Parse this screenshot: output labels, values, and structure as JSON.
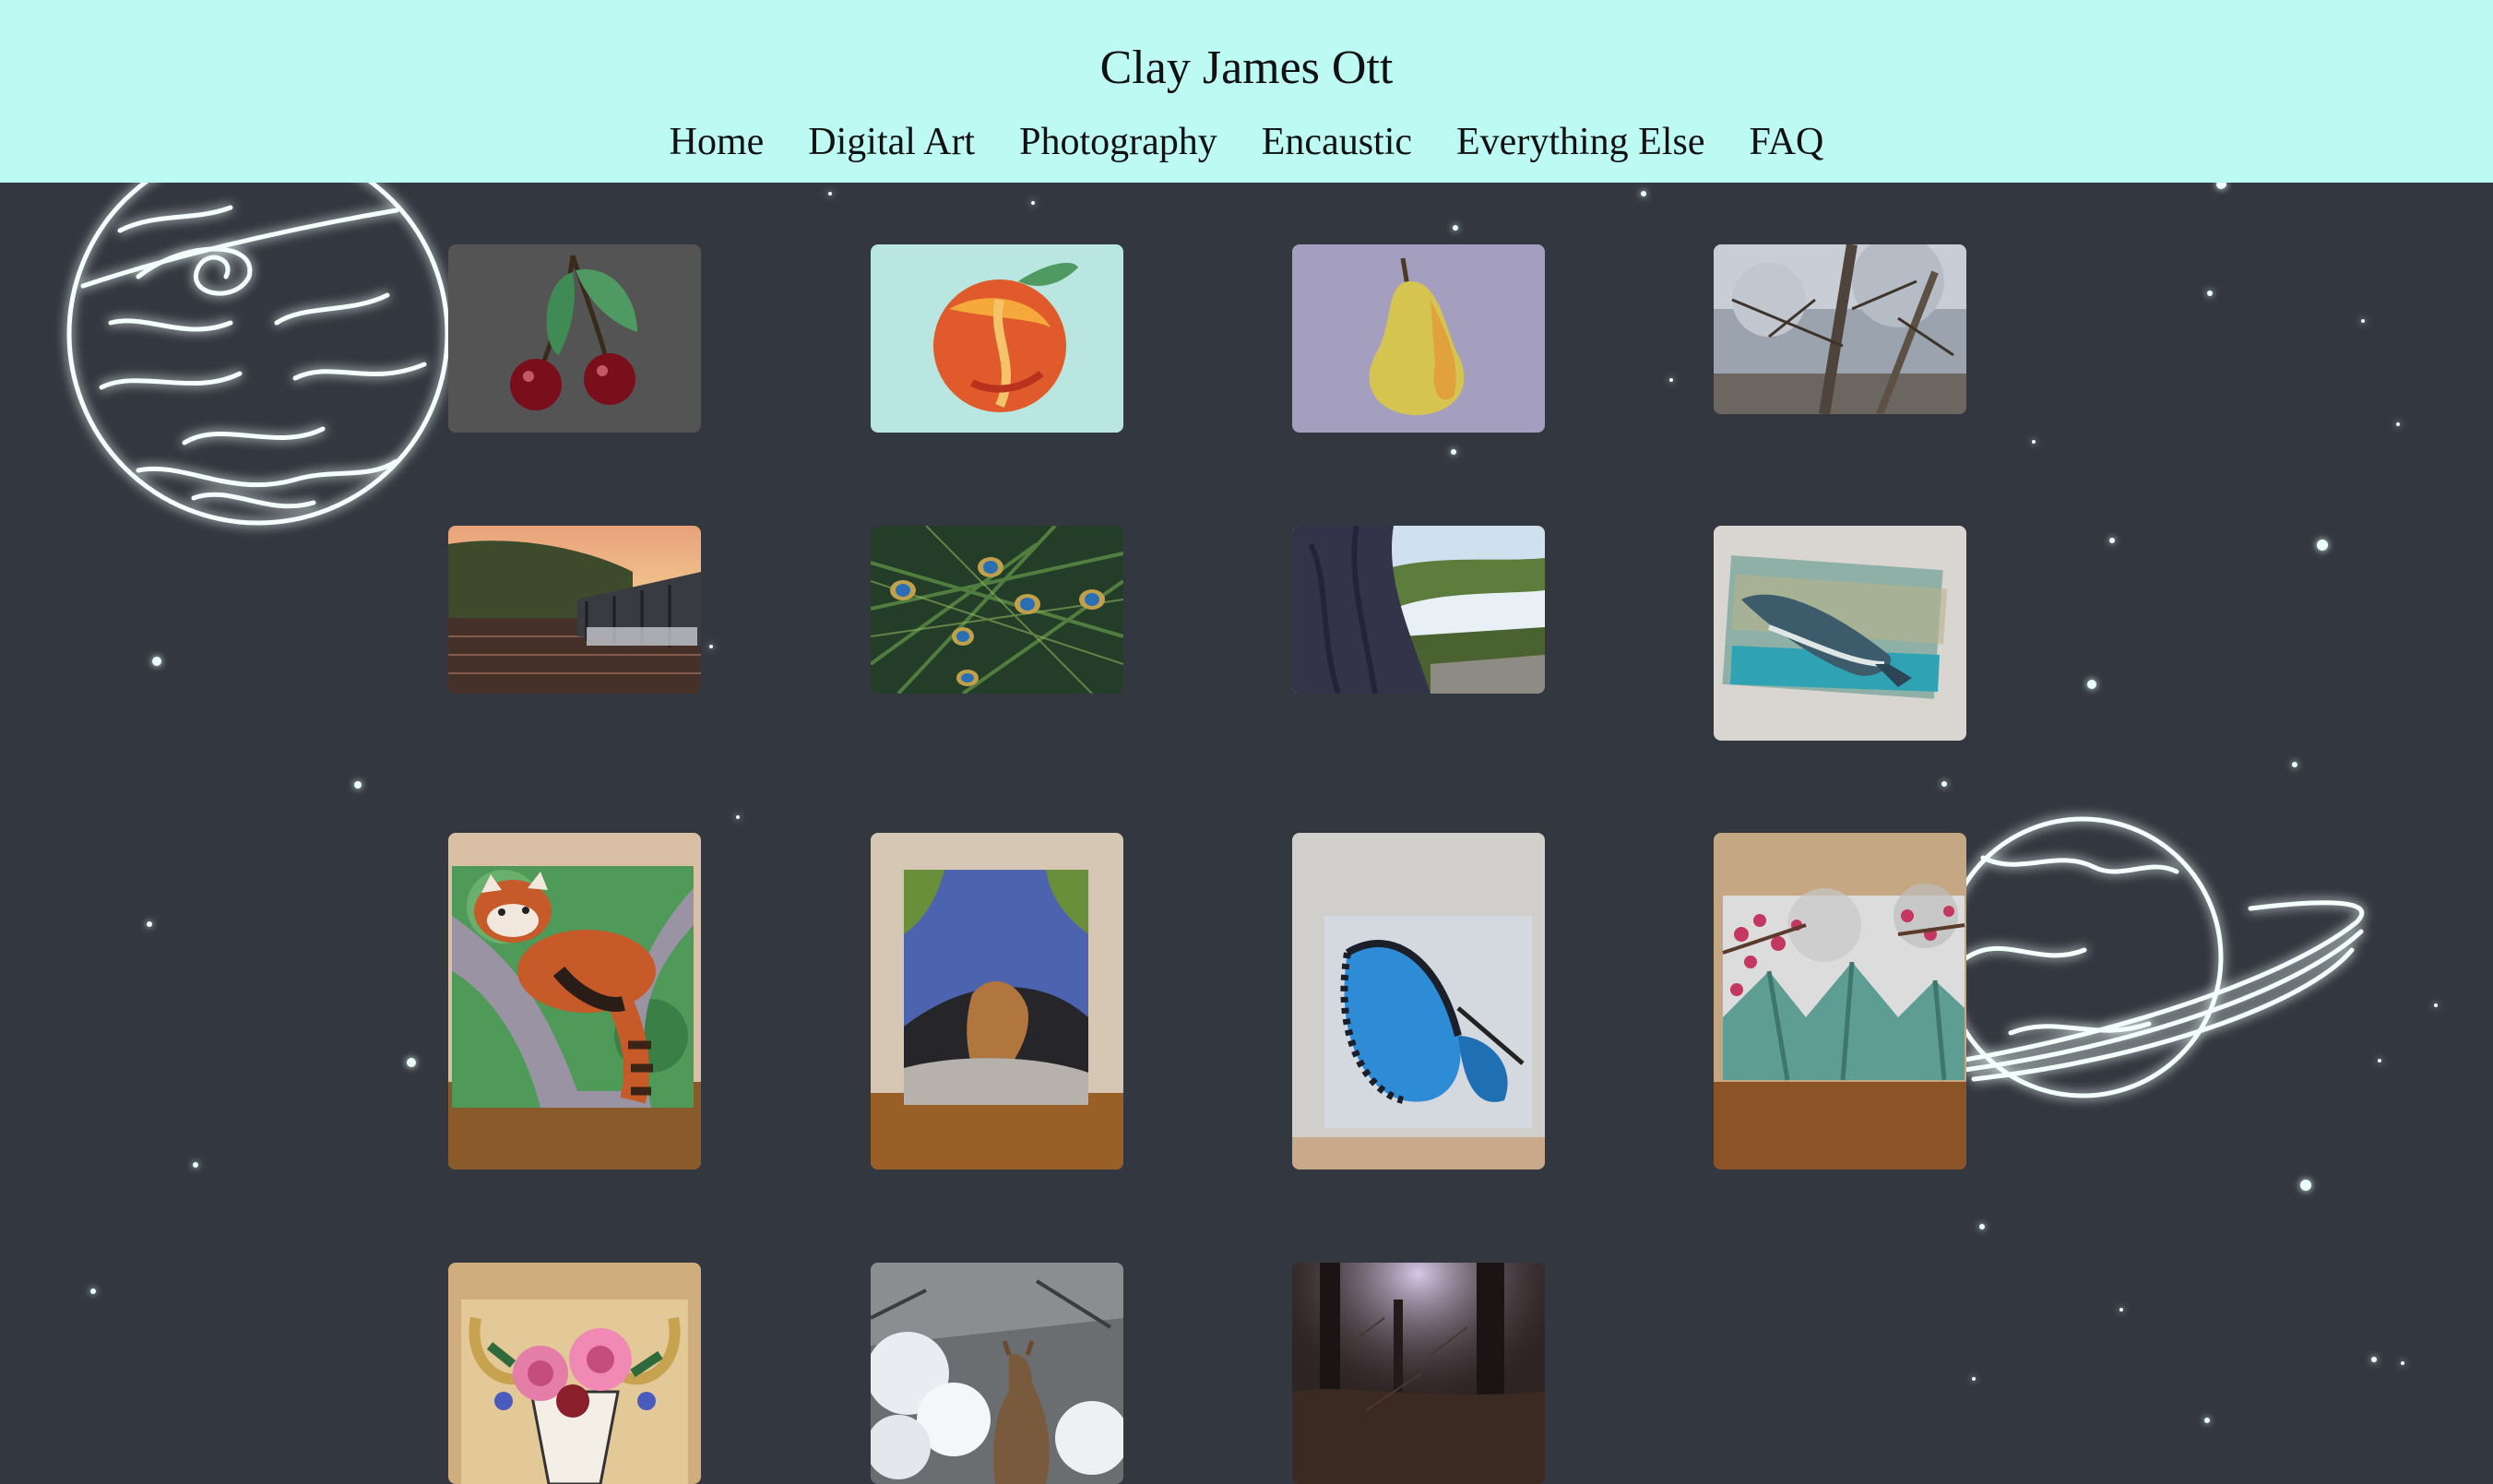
{
  "header": {
    "title": "Clay James Ott",
    "nav": [
      "Home",
      "Digital Art",
      "Photography",
      "Encaustic",
      "Everything Else",
      "FAQ"
    ]
  },
  "gallery": {
    "items": [
      {
        "subject": "cherries",
        "bg": "#545454"
      },
      {
        "subject": "peach",
        "bg": "#b9e6e0"
      },
      {
        "subject": "pear",
        "bg": "#a49fbf"
      },
      {
        "subject": "tree-branches-photo",
        "bg": "#8d93a0"
      },
      {
        "subject": "lake-dock-sunset-photo",
        "bg": "#2a2a26"
      },
      {
        "subject": "peacock-feathers-photo",
        "bg": "#2c4a2c"
      },
      {
        "subject": "tree-river-view-photo",
        "bg": "#2b2e3c"
      },
      {
        "subject": "whale-encaustic",
        "bg": "#d4d1cc"
      },
      {
        "subject": "red-panda-encaustic",
        "bg": "#d9c0a4"
      },
      {
        "subject": "atlas-figure-encaustic",
        "bg": "#cbb9a4"
      },
      {
        "subject": "blue-butterfly-encaustic",
        "bg": "#c9c7c4"
      },
      {
        "subject": "blossom-mountains-encaustic",
        "bg": "#cbae88"
      },
      {
        "subject": "floral-skull-painting",
        "bg": "#d9bc8f"
      },
      {
        "subject": "deer-in-snow-photo",
        "bg": "#5c5f62"
      },
      {
        "subject": "forest-sunlight-photo",
        "bg": "#3a2f2f"
      }
    ]
  }
}
